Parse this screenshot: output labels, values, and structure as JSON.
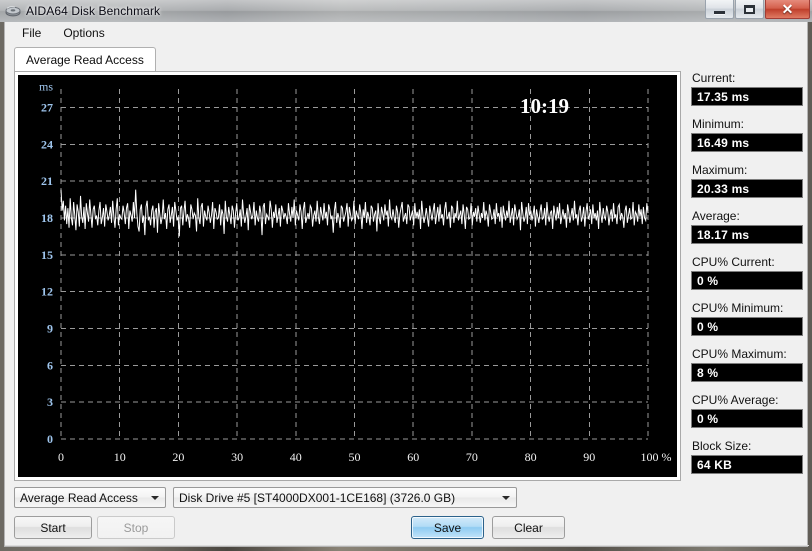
{
  "window": {
    "title": "AIDA64 Disk Benchmark",
    "icon": "disk-icon",
    "buttons": {
      "minimize": "minimize",
      "maximize": "maximize",
      "close": "✕"
    }
  },
  "menu": {
    "items": [
      {
        "label": "File"
      },
      {
        "label": "Options"
      }
    ]
  },
  "tabs": [
    {
      "label": "Average Read Access",
      "active": true
    }
  ],
  "chart_overlay": {
    "timer": "10:19"
  },
  "stats": [
    {
      "label": "Current:",
      "value": "17.35 ms",
      "name": "current"
    },
    {
      "label": "Minimum:",
      "value": "16.49 ms",
      "name": "minimum"
    },
    {
      "label": "Maximum:",
      "value": "20.33 ms",
      "name": "maximum"
    },
    {
      "label": "Average:",
      "value": "18.17 ms",
      "name": "average"
    },
    {
      "label": "CPU% Current:",
      "value": "0 %",
      "name": "cpu-current"
    },
    {
      "label": "CPU% Minimum:",
      "value": "0 %",
      "name": "cpu-minimum"
    },
    {
      "label": "CPU% Maximum:",
      "value": "8 %",
      "name": "cpu-maximum"
    },
    {
      "label": "CPU% Average:",
      "value": "0 %",
      "name": "cpu-average"
    },
    {
      "label": "Block Size:",
      "value": "64 KB",
      "name": "block-size"
    }
  ],
  "controls": {
    "mode_combo": {
      "value": "Average Read Access"
    },
    "drive_combo": {
      "value": "Disk Drive #5  [ST4000DX001-1CE168]  (3726.0 GB)"
    },
    "start": "Start",
    "stop": "Stop",
    "save": "Save",
    "clear": "Clear"
  },
  "colors": {
    "plot_background": "#000000",
    "grid": "#9a9a9a",
    "trace": "#ffffff",
    "y_axis_label": "#9fc6ee",
    "x_axis_label": "#f2f2f2",
    "timer": "#ffffff",
    "close_button": "#bf3f2c",
    "default_button": "#8ecbf1"
  },
  "chart_data": {
    "type": "line",
    "title": "Average Read Access",
    "xlabel": "100 %",
    "ylabel": "ms",
    "xlim": [
      0,
      100
    ],
    "ylim": [
      0,
      28.5
    ],
    "grid": true,
    "legend": null,
    "xticks": [
      0,
      10,
      20,
      30,
      40,
      50,
      60,
      70,
      80,
      90,
      100
    ],
    "xticklabels": [
      "0",
      "10",
      "20",
      "30",
      "40",
      "50",
      "60",
      "70",
      "80",
      "90",
      "100 %"
    ],
    "yticks": [
      0,
      3,
      6,
      9,
      12,
      15,
      18,
      21,
      24,
      27
    ],
    "yticklabels": [
      "0",
      "3",
      "6",
      "9",
      "12",
      "15",
      "18",
      "21",
      "24",
      "27"
    ],
    "series": [
      {
        "name": "Average Read Access (ms)",
        "color": "#ffffff",
        "mean": 18.17,
        "min": 16.49,
        "max": 20.33,
        "values": [
          20.3,
          18.6,
          19.4,
          17.8,
          19.0,
          17.5,
          18.8,
          17.2,
          19.6,
          18.0,
          17.4,
          19.3,
          18.2,
          17.0,
          19.1,
          18.5,
          17.3,
          19.8,
          18.1,
          17.6,
          18.9,
          17.1,
          19.2,
          18.4,
          17.7,
          19.5,
          18.3,
          17.2,
          18.7,
          19.0,
          17.9,
          18.2,
          17.4,
          18.6,
          19.3,
          17.5,
          18.0,
          18.8,
          17.3,
          19.1,
          18.5,
          17.8,
          18.2,
          18.9,
          17.6,
          19.4,
          18.1,
          17.2,
          18.7,
          19.6,
          17.4,
          18.3,
          18.0,
          17.9,
          19.0,
          18.4,
          17.5,
          18.8,
          19.2,
          17.1,
          18.6,
          18.2,
          17.7,
          19.3,
          18.0,
          20.3,
          18.4,
          17.3,
          16.9,
          18.7,
          19.1,
          17.6,
          18.2,
          16.6,
          18.9,
          19.4,
          17.8,
          18.1,
          17.4,
          18.6,
          19.0,
          17.2,
          18.5,
          18.8,
          16.8,
          19.2,
          18.3,
          17.5,
          18.0,
          19.5,
          17.9,
          18.4,
          17.1,
          18.7,
          19.1,
          17.6,
          18.2,
          18.9,
          17.3,
          19.3,
          18.6,
          17.8,
          18.1,
          16.5,
          18.8,
          19.0,
          17.4,
          18.5,
          19.4,
          17.7,
          18.3,
          18.0,
          17.2,
          19.1,
          18.7,
          17.9,
          18.4,
          18.2,
          16.9,
          19.6,
          18.0,
          17.5,
          18.9,
          19.2,
          17.3,
          18.6,
          18.1,
          17.8,
          19.0,
          18.4,
          17.6,
          18.2,
          19.3,
          17.1,
          18.8,
          18.5,
          17.9,
          18.0,
          19.1,
          17.4,
          18.7,
          18.3,
          16.7,
          19.4,
          18.1,
          17.7,
          18.9,
          18.2,
          17.5,
          19.0,
          18.6,
          17.2,
          18.4,
          19.2,
          17.8,
          18.0,
          18.7,
          17.3,
          19.5,
          18.3,
          17.6,
          18.1,
          18.8,
          17.0,
          19.1,
          18.5,
          17.9,
          18.2,
          19.3,
          17.4,
          18.6,
          18.0,
          17.7,
          19.0,
          18.4,
          16.6,
          18.9,
          19.2,
          17.5,
          18.3,
          18.1,
          17.8,
          19.4,
          18.7,
          17.2,
          18.5,
          18.0,
          19.1,
          17.6,
          18.2,
          18.8,
          17.3,
          19.0,
          18.6,
          17.9,
          18.4,
          18.1,
          17.5,
          19.2,
          18.3,
          17.7,
          18.9,
          18.0,
          19.5,
          17.4,
          18.6,
          18.2,
          17.8,
          19.1,
          18.5,
          17.1,
          18.7,
          19.3,
          17.6,
          18.0,
          18.4,
          17.9,
          19.0,
          18.8,
          17.3,
          18.2,
          18.6,
          17.7,
          19.4,
          18.1,
          17.5,
          18.9,
          18.3,
          17.8,
          19.2,
          18.0,
          18.5,
          17.4,
          19.1,
          18.7,
          17.9,
          18.2,
          16.8,
          18.6,
          19.3,
          17.6,
          18.4,
          18.0,
          17.2,
          19.0,
          18.8,
          17.7,
          18.1,
          18.5,
          19.2,
          17.3,
          18.9,
          18.3,
          17.8,
          18.0,
          19.4,
          17.5,
          18.6,
          18.2,
          17.9,
          19.1,
          18.4,
          17.1,
          18.7,
          18.0,
          19.3,
          17.6,
          18.5,
          18.1,
          17.4,
          19.0,
          18.8,
          17.7,
          18.3,
          18.6,
          16.9,
          19.2,
          18.0,
          17.5,
          18.9,
          18.4,
          17.8,
          19.1,
          18.2,
          18.6,
          17.3,
          19.5,
          18.1,
          17.9,
          18.7,
          18.0,
          17.6,
          19.0,
          18.5,
          17.2,
          18.3,
          18.8,
          19.3,
          17.7,
          18.1,
          18.4,
          17.5,
          19.1,
          18.9,
          17.8,
          18.2,
          18.6,
          17.4,
          19.2,
          18.0,
          18.5,
          17.9,
          18.7,
          17.1,
          19.4,
          18.3,
          17.6,
          18.1,
          18.8,
          18.0,
          17.3,
          19.0,
          18.4,
          17.8,
          18.6,
          19.2,
          17.5,
          18.2,
          18.9,
          17.7,
          19.1,
          18.0,
          18.3,
          17.4,
          18.7,
          19.3,
          17.9,
          18.1,
          18.5,
          17.2,
          19.0,
          18.8,
          17.6,
          18.4,
          18.0,
          19.4,
          17.8,
          18.2,
          18.6,
          17.5,
          19.1,
          18.3,
          17.1,
          18.9,
          18.7,
          17.9,
          18.0,
          19.2,
          17.4,
          18.5,
          18.1,
          18.8,
          17.7,
          19.0,
          18.3,
          17.6,
          18.4,
          18.0,
          19.3,
          17.8,
          18.6,
          18.2,
          17.3,
          19.1,
          18.5,
          17.9,
          18.0,
          18.7,
          17.5,
          19.2,
          18.1,
          18.4,
          17.7,
          18.9,
          17.2,
          19.0,
          18.3,
          17.8,
          18.6,
          18.0,
          19.4,
          17.6,
          18.2,
          18.8,
          17.4,
          19.1,
          18.5,
          17.9,
          18.1,
          18.7,
          17.0,
          19.3,
          18.4,
          17.7,
          18.0,
          18.9,
          17.5,
          19.2,
          18.2,
          18.6,
          17.8,
          18.3,
          19.0,
          17.3,
          18.7,
          18.1,
          17.6,
          18.5,
          19.1,
          17.9,
          18.0,
          18.8,
          17.4,
          19.3,
          18.2,
          17.7,
          18.4,
          18.6,
          17.1,
          19.0,
          18.3,
          17.8,
          18.9,
          18.0,
          19.2,
          17.5,
          18.1,
          18.7,
          17.9,
          18.4,
          17.2,
          19.1,
          18.5,
          17.6,
          18.2,
          18.8,
          17.8,
          19.4,
          18.0,
          18.3,
          17.4,
          18.6,
          19.0,
          17.7,
          18.1,
          18.9,
          17.3,
          18.5,
          19.2,
          17.9,
          18.2,
          18.7,
          17.5,
          19.1,
          18.0,
          18.4,
          17.8,
          18.6,
          17.1,
          19.3,
          18.3,
          17.6,
          18.8,
          18.1,
          17.9,
          19.0,
          18.5,
          17.4,
          18.2,
          18.7,
          17.7,
          19.2,
          18.0,
          18.3,
          17.5,
          18.9,
          19.1,
          17.8,
          18.4,
          18.1,
          17.2,
          18.6,
          19.0,
          17.6,
          18.2,
          18.8,
          17.9,
          18.0,
          19.3,
          17.4,
          18.5,
          18.3,
          17.7,
          19.1,
          18.1,
          18.7,
          17.5,
          18.9,
          18.0,
          17.8,
          19.2,
          18.4
        ]
      }
    ]
  }
}
